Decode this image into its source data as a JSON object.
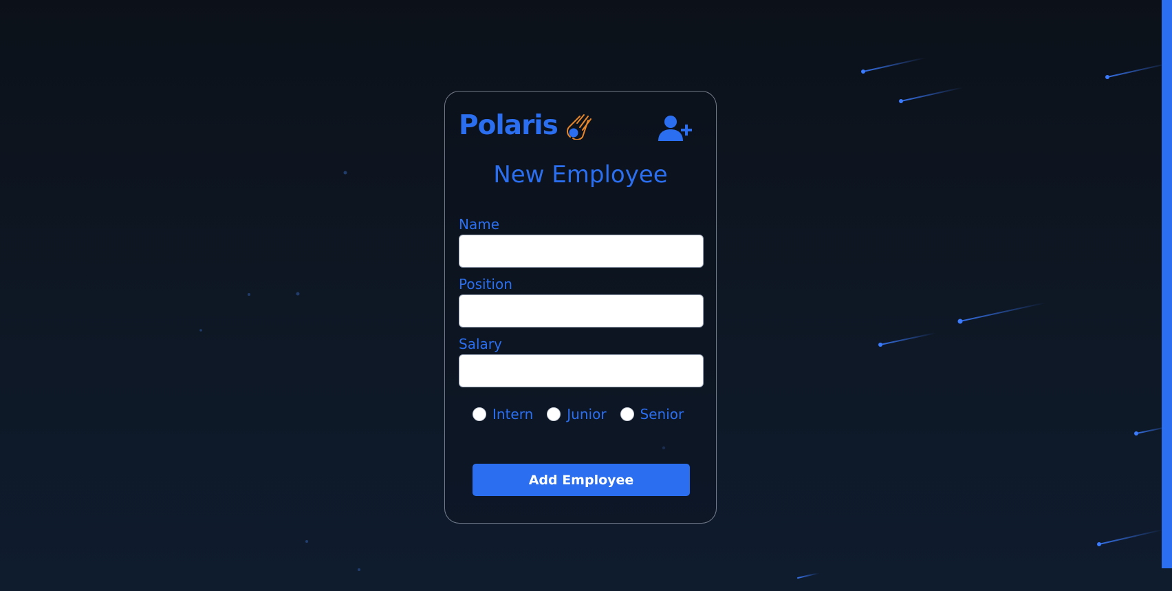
{
  "brand": {
    "name": "Polaris",
    "logo_icon": "meteor-icon",
    "accent_color": "#2b6ff0",
    "logo_flame_color": "#e8862a"
  },
  "header": {
    "action_icon": "user-plus-icon"
  },
  "form": {
    "title": "New Employee",
    "fields": [
      {
        "label": "Name",
        "value": "",
        "placeholder": ""
      },
      {
        "label": "Position",
        "value": "",
        "placeholder": ""
      },
      {
        "label": "Salary",
        "value": "",
        "placeholder": ""
      }
    ],
    "level_options": [
      {
        "label": "Intern",
        "selected": false
      },
      {
        "label": "Junior",
        "selected": false
      },
      {
        "label": "Senior",
        "selected": false
      }
    ],
    "submit_label": "Add Employee"
  }
}
